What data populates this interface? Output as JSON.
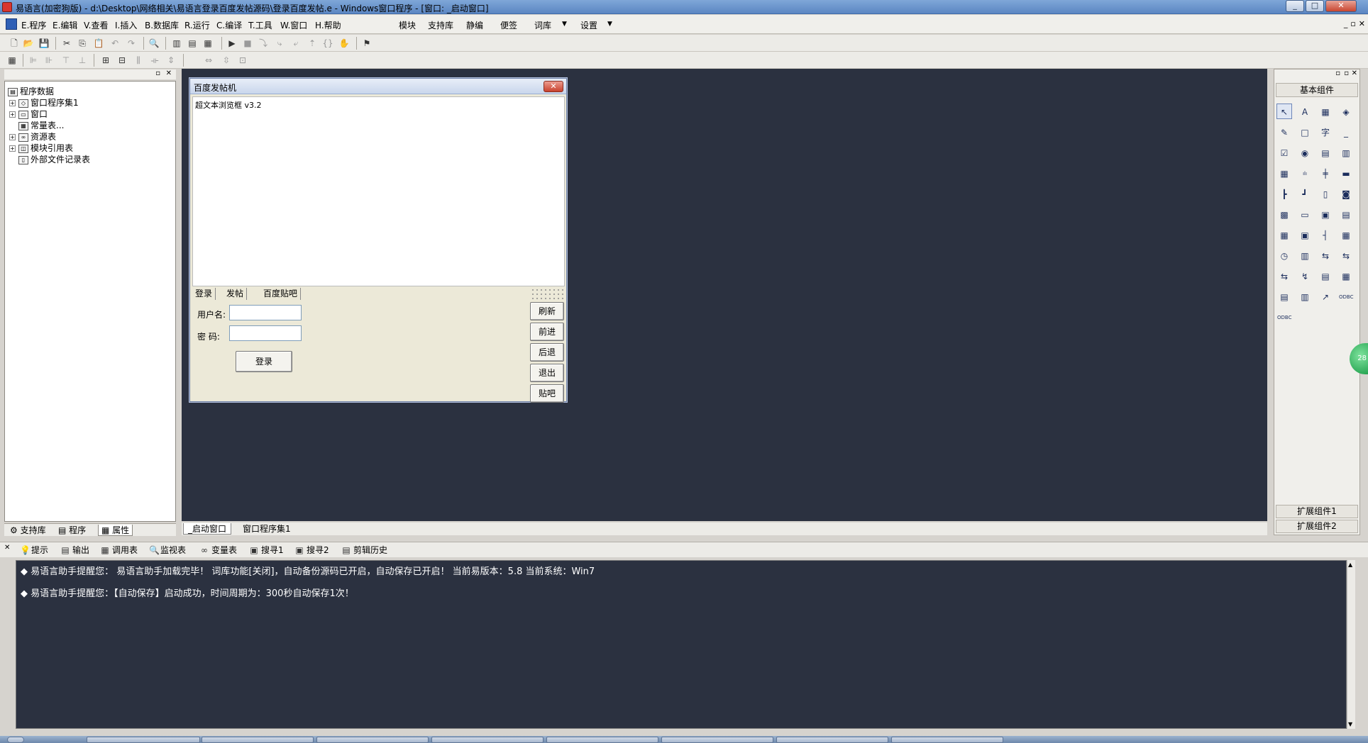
{
  "window": {
    "title": "易语言(加密狗版) - d:\\Desktop\\网络相关\\易语言登录百度发帖源码\\登录百度发帖.e - Windows窗口程序 - [窗口: _启动窗口]",
    "min": "_",
    "max": "□",
    "close": "✕"
  },
  "menu": {
    "program": "E.程序",
    "edit": "E.编辑",
    "view": "V.查看",
    "insert": "I.插入",
    "database": "B.数据库",
    "run": "R.运行",
    "compile": "C.编译",
    "tools": "T.工具",
    "window": "W.窗口",
    "help": "H.帮助",
    "module": "模块",
    "support": "支持库",
    "jingbian": "静编",
    "note": "便签",
    "ciku": "词库",
    "settings": "设置",
    "mdi_min": "_",
    "mdi_restore": "▫",
    "mdi_close": "✕"
  },
  "tree": {
    "root": "程序数据",
    "items": [
      "窗口程序集1",
      "窗口",
      "常量表...",
      "资源表",
      "模块引用表",
      "外部文件记录表"
    ]
  },
  "lefttabs": {
    "support": "支持库",
    "program": "程序",
    "props": "属性"
  },
  "designer": {
    "title": "百度发帖机",
    "browser_label": "超文本浏览框 v3.2",
    "tabs": [
      "登录",
      "发帖",
      "百度贴吧"
    ],
    "username_label": "用户名:",
    "password_label": "密 码:",
    "login_button": "登录",
    "side_buttons": [
      "刷新",
      "前进",
      "后退",
      "退出",
      "贴吧"
    ]
  },
  "worktabs": {
    "start_window": "_启动窗口",
    "program_set": "窗口程序集1"
  },
  "components": {
    "title": "基本组件",
    "ext1": "扩展组件1",
    "ext2": "扩展组件2",
    "icons": [
      "↖",
      "A",
      "▦",
      "◈",
      "✎",
      "□",
      "字",
      "_",
      "☑",
      "◉",
      "▤",
      "▥",
      "▦",
      "ılı",
      "╪",
      "▬",
      "┣",
      "┛",
      "▯",
      "◙",
      "▩",
      "▭",
      "▣",
      "▤",
      "▦",
      "▣",
      "┤",
      "▦",
      "◷",
      "▥",
      "⇆",
      "⇆",
      "⇆",
      "↯",
      "▤",
      "▦",
      "▤",
      "▥",
      "↗",
      "ODBC",
      "ODBC"
    ]
  },
  "bottomtabs": [
    "提示",
    "输出",
    "调用表",
    "监视表",
    "变量表",
    "搜寻1",
    "搜寻2",
    "剪辑历史"
  ],
  "output": {
    "lines": [
      "◆ 易语言助手提醒您：  易语言助手加载完毕！  词库功能[关闭]，自动备份源码已开启，自动保存已开启！  当前易版本：5.8  当前系统：Win7",
      "◆ 易语言助手提醒您：【自动保存】启动成功，时间周期为：300秒自动保存1次！"
    ]
  },
  "badge": "28",
  "colors": {
    "workspace": "#2b3140",
    "titlebar": "#6b93cb"
  }
}
